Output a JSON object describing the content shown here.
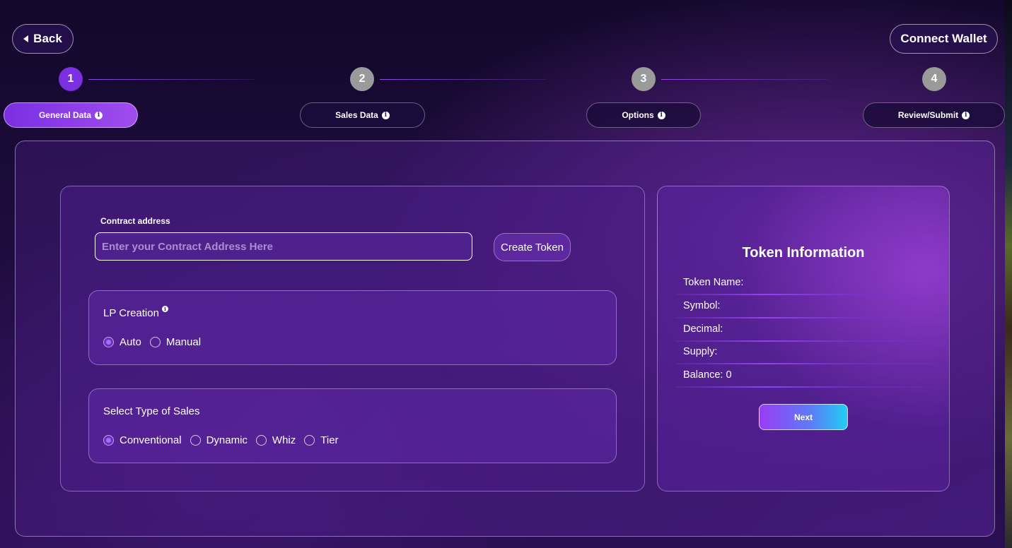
{
  "header": {
    "back_label": "Back",
    "connect_wallet_label": "Connect Wallet"
  },
  "steps": [
    {
      "number": "1",
      "label": "General Data",
      "active": true
    },
    {
      "number": "2",
      "label": "Sales Data",
      "active": false
    },
    {
      "number": "3",
      "label": "Options",
      "active": false
    },
    {
      "number": "4",
      "label": "Review/Submit",
      "active": false
    }
  ],
  "form": {
    "contract_label": "Contract address",
    "contract_value": "",
    "contract_placeholder": "Enter your Contract Address Here",
    "create_token_label": "Create Token",
    "lp_creation": {
      "title": "LP Creation",
      "options": [
        "Auto",
        "Manual"
      ],
      "selected": "Auto"
    },
    "sales_type": {
      "title": "Select Type of Sales",
      "options": [
        "Conventional",
        "Dynamic",
        "Whiz",
        "Tier"
      ],
      "selected": "Conventional"
    }
  },
  "token_info": {
    "title": "Token Information",
    "rows": [
      "Token Name:",
      "Symbol:",
      "Decimal:",
      "Supply:",
      "Balance: 0"
    ],
    "next_label": "Next"
  },
  "icons": {
    "back": "triangle-left-icon",
    "info": "info-icon"
  },
  "colors": {
    "accent": "#7a2fe0",
    "step_inactive": "#9a9a9a",
    "next_gradient_start": "#9a3cf5",
    "next_gradient_end": "#1fd0f5"
  }
}
